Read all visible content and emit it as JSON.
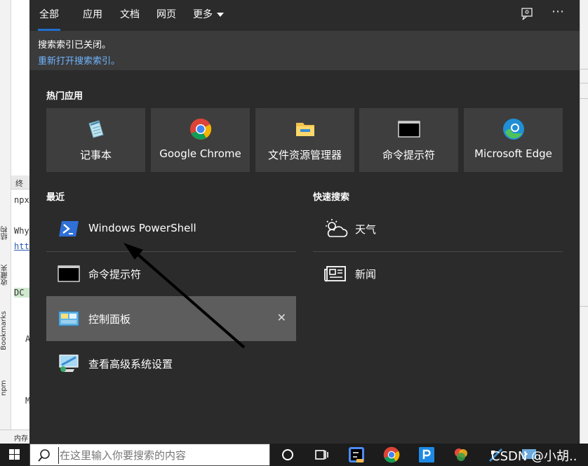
{
  "ide": {
    "tab_label": "终端",
    "code_lines": [
      "npx",
      "Why",
      "htt",
      "DC",
      "A",
      "M"
    ],
    "side_labels": [
      "结构",
      "收藏夹",
      "Bookmarks",
      "npm"
    ],
    "bottom_tab": "内存"
  },
  "panel": {
    "tabs": [
      {
        "label": "全部",
        "active": true
      },
      {
        "label": "应用",
        "active": false
      },
      {
        "label": "文档",
        "active": false
      },
      {
        "label": "网页",
        "active": false
      },
      {
        "label": "更多",
        "active": false
      }
    ],
    "feedback_icon": "feedback-icon",
    "options_icon": "⋯",
    "notice": {
      "title": "搜索索引已关闭。",
      "link": "重新打开搜索索引。"
    },
    "popular_apps_title": "热门应用",
    "popular_apps": [
      {
        "label": "记事本",
        "icon": "notepad-icon"
      },
      {
        "label": "Google Chrome",
        "icon": "chrome-icon"
      },
      {
        "label": "文件资源管理器",
        "icon": "file-explorer-icon"
      },
      {
        "label": "命令提示符",
        "icon": "command-prompt-icon"
      },
      {
        "label": "Microsoft Edge",
        "icon": "edge-icon"
      }
    ],
    "recent_title": "最近",
    "recent_items": [
      {
        "label": "Windows PowerShell",
        "icon": "powershell-icon"
      },
      {
        "label": "命令提示符",
        "icon": "command-prompt-icon"
      },
      {
        "label": "控制面板",
        "icon": "control-panel-icon",
        "selected": true
      },
      {
        "label": "查看高级系统设置",
        "icon": "system-settings-icon"
      }
    ],
    "close_glyph": "✕",
    "quick_search_title": "快速搜索",
    "quick_search_items": [
      {
        "label": "天气",
        "icon": "weather-icon"
      },
      {
        "label": "新闻",
        "icon": "news-icon"
      }
    ]
  },
  "taskbar": {
    "search_placeholder": "在这里输入你要搜索的内容",
    "watermark": "CSDN @小胡..",
    "icons": [
      "task-view-icon",
      "multitask-icon",
      "goland-icon",
      "chrome-icon",
      "pycharm-icon",
      "color-app-icon",
      "tool-icon",
      "shell-icon"
    ]
  },
  "colors": {
    "panel_bg": "#2b2b2b",
    "tile_bg": "#3e3e3e",
    "accent": "#1f6fcc",
    "link": "#6fb4ff",
    "selected_bg": "#5d5d5d"
  }
}
